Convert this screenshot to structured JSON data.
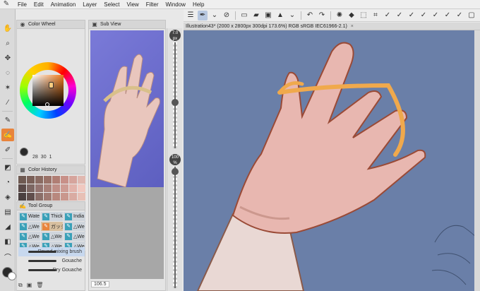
{
  "menubar": {
    "items": [
      "File",
      "Edit",
      "Animation",
      "Layer",
      "Select",
      "View",
      "Filter",
      "Window",
      "Help"
    ]
  },
  "toolbar": {
    "icons": [
      "menu-icon",
      "pen-select-icon",
      "chevron-down-icon",
      "no-entry-icon",
      "new-file-icon",
      "open-folder-icon",
      "save-icon",
      "triangle-icon",
      "chevron-down-icon",
      "undo-icon",
      "redo-icon",
      "loading-icon",
      "fill-icon",
      "transform-icon",
      "crop-icon",
      "checkmark-icon",
      "checkmark-icon",
      "checkmark-icon",
      "checkmark-icon",
      "checkmark-icon",
      "checkmark-icon",
      "checkmark-icon",
      "frame-icon"
    ]
  },
  "panels": {
    "color_wheel": {
      "title": "Color Wheel",
      "values": [
        "28",
        "30",
        "1"
      ]
    },
    "color_history": {
      "title": "Color History",
      "swatches": [
        "#6e5a52",
        "#7a6058",
        "#8a6b62",
        "#9a7268",
        "#b07e74",
        "#c89088",
        "#d6a49c",
        "#e0b8b0",
        "#5a4a48",
        "#7c6662",
        "#947470",
        "#a88078",
        "#bf8e86",
        "#ce9c94",
        "#e2b2aa",
        "#f0c8c0",
        "#4a4040",
        "#604e4c",
        "#8a6e68",
        "#a07a72",
        "#b8887e",
        "#c9978d",
        "#d9aba2",
        "#e7c0b6"
      ]
    },
    "tool_group": {
      "title": "Tool Group",
      "tabs": [
        "Wate",
        "Thick",
        "India",
        "△We",
        "ガッシ",
        "△We",
        "△We",
        "△We",
        "△We",
        "△We",
        "△We",
        "△We"
      ],
      "brushes": [
        "Round mixing brush",
        "Gouache",
        "Dry Gouache"
      ]
    },
    "sub_view": {
      "title": "Sub View",
      "zoom": "106.5"
    }
  },
  "sliders": {
    "brush_size": "7.0 px",
    "opacity": "100 %"
  },
  "document": {
    "tab_title": "Illustration43* (2000 x 2800px 300dpi 173.6%)  RGB sRGB IEC61966-2.1)"
  },
  "colors": {
    "accent_tool": "#e8843c",
    "canvas_background": "#6a7fa8",
    "reference_background": "#6e6ed0",
    "elastic_band": "#f0a94c"
  }
}
